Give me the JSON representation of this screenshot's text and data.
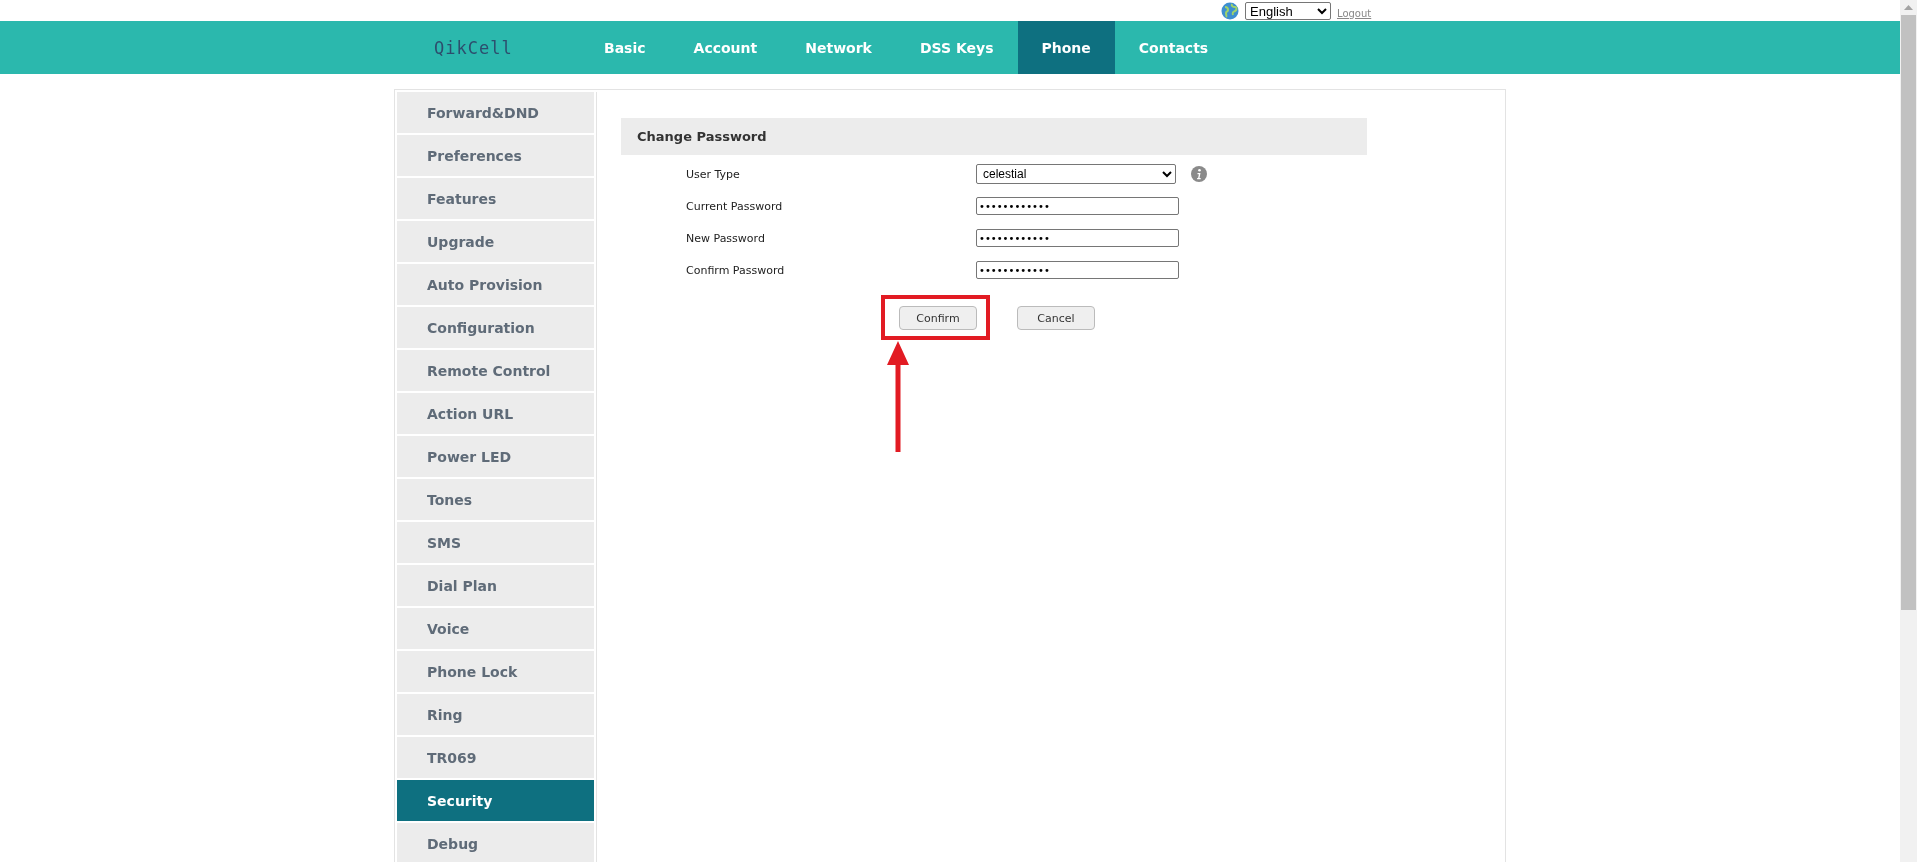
{
  "top_bar": {
    "language": "English",
    "logout": "Logout"
  },
  "logo": {
    "text": "QikCell"
  },
  "nav_tabs": [
    {
      "label": "Basic",
      "selected": false
    },
    {
      "label": "Account",
      "selected": false
    },
    {
      "label": "Network",
      "selected": false
    },
    {
      "label": "DSS Keys",
      "selected": false
    },
    {
      "label": "Phone",
      "selected": true
    },
    {
      "label": "Contacts",
      "selected": false
    }
  ],
  "sidebar": {
    "items": [
      {
        "label": "Forward&DND",
        "selected": false
      },
      {
        "label": "Preferences",
        "selected": false
      },
      {
        "label": "Features",
        "selected": false
      },
      {
        "label": "Upgrade",
        "selected": false
      },
      {
        "label": "Auto Provision",
        "selected": false
      },
      {
        "label": "Configuration",
        "selected": false
      },
      {
        "label": "Remote Control",
        "selected": false
      },
      {
        "label": "Action URL",
        "selected": false
      },
      {
        "label": "Power LED",
        "selected": false
      },
      {
        "label": "Tones",
        "selected": false
      },
      {
        "label": "SMS",
        "selected": false
      },
      {
        "label": "Dial Plan",
        "selected": false
      },
      {
        "label": "Voice",
        "selected": false
      },
      {
        "label": "Phone Lock",
        "selected": false
      },
      {
        "label": "Ring",
        "selected": false
      },
      {
        "label": "TR069",
        "selected": false
      },
      {
        "label": "Security",
        "selected": true
      },
      {
        "label": "Debug",
        "selected": false
      }
    ]
  },
  "change_password": {
    "title": "Change Password",
    "fields": [
      {
        "kind": "select",
        "label": "User Type",
        "value": "celestial"
      },
      {
        "kind": "password",
        "label": "Current Password",
        "value": "••••••••••••"
      },
      {
        "kind": "password",
        "label": "New Password",
        "value": "••••••••••••"
      },
      {
        "kind": "password",
        "label": "Confirm Password",
        "value": "••••••••••••"
      }
    ],
    "buttons": [
      "Confirm",
      "Cancel"
    ]
  }
}
